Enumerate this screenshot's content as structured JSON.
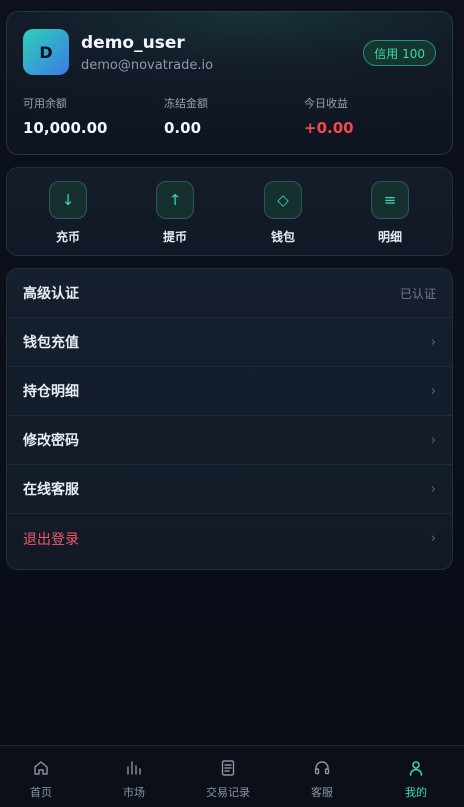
{
  "profile": {
    "avatar_letter": "D",
    "username": "demo_user",
    "email": "demo@novatrade.io",
    "credit_badge": "信用 100",
    "stats": [
      {
        "label": "可用余额",
        "value": "10,000.00"
      },
      {
        "label": "冻结金额",
        "value": "0.00"
      },
      {
        "label": "今日收益",
        "value": "+0.00"
      }
    ]
  },
  "actions": [
    {
      "label": "充币",
      "icon": "arrow-down-icon",
      "glyph": "↓"
    },
    {
      "label": "提币",
      "icon": "arrow-up-icon",
      "glyph": "↑"
    },
    {
      "label": "钱包",
      "icon": "diamond-icon",
      "glyph": "◇"
    },
    {
      "label": "明细",
      "icon": "list-icon",
      "glyph": "≡"
    }
  ],
  "menu": [
    {
      "label": "高级认证",
      "right": "已认证"
    },
    {
      "label": "钱包充值",
      "right": "›"
    },
    {
      "label": "持仓明细",
      "right": "›"
    },
    {
      "label": "修改密码",
      "right": "›"
    },
    {
      "label": "在线客服",
      "right": "›"
    },
    {
      "label": "退出登录",
      "right": "›"
    }
  ],
  "nav": [
    {
      "label": "首页",
      "icon": "home-icon"
    },
    {
      "label": "市场",
      "icon": "bar-chart-icon"
    },
    {
      "label": "交易记录",
      "icon": "document-icon"
    },
    {
      "label": "客服",
      "icon": "headset-icon"
    },
    {
      "label": "我的",
      "icon": "user-icon",
      "active": true
    }
  ],
  "colors": {
    "accent": "#3fd7b6",
    "danger": "#f0566a",
    "profit": "#f2484f",
    "background": "#0a0e18"
  }
}
